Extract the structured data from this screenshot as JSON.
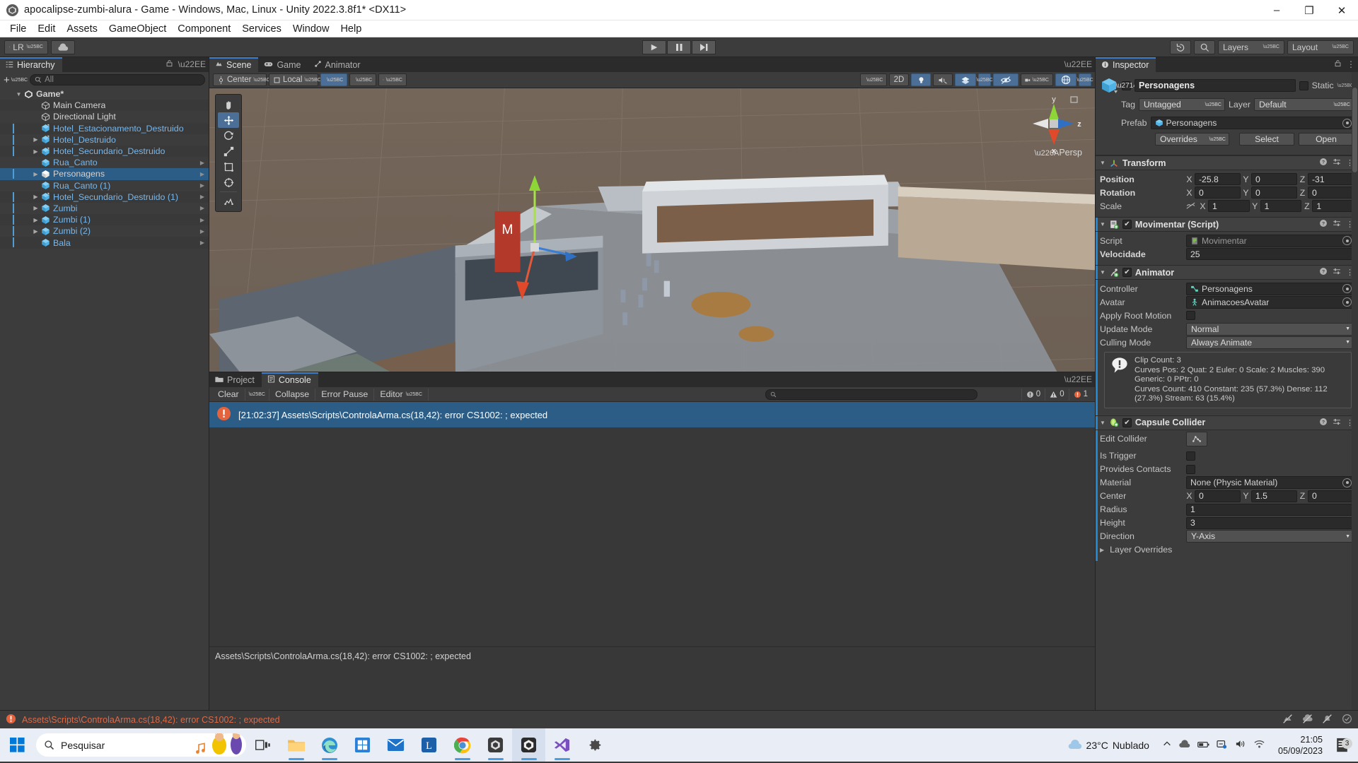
{
  "window": {
    "title": "apocalipse-zumbi-alura - Game - Windows, Mac, Linux - Unity 2022.3.8f1* <DX11>",
    "minimize": "–",
    "maximize": "❐",
    "close": "✕"
  },
  "menubar": {
    "items": [
      "File",
      "Edit",
      "Assets",
      "GameObject",
      "Component",
      "Services",
      "Window",
      "Help"
    ]
  },
  "toolbar": {
    "account_label": "LR",
    "cloud_label": "cloud-icon",
    "play": "▶",
    "pause": "❚❚",
    "step": "▶|",
    "history_icon": "undo-history-icon",
    "search_icon": "search-icon",
    "layers": "Layers",
    "layout": "Layout"
  },
  "hierarchy": {
    "tab": "Hierarchy",
    "search_placeholder": "All",
    "plus": "+",
    "items": [
      {
        "label": "Game*",
        "depth": 0,
        "arrow": "down",
        "icon": "unity-scene-icon",
        "color": "white",
        "prefab": false,
        "bold": true,
        "selected": false,
        "chevron": false
      },
      {
        "label": "Main Camera",
        "depth": 2,
        "arrow": "none",
        "icon": "gameobject-icon",
        "color": "white",
        "prefab": false,
        "bold": false,
        "selected": false,
        "chevron": false
      },
      {
        "label": "Directional Light",
        "depth": 2,
        "arrow": "none",
        "icon": "gameobject-icon",
        "color": "white",
        "prefab": false,
        "bold": false,
        "selected": false,
        "chevron": false
      },
      {
        "label": "Hotel_Estacionamento_Destruido",
        "depth": 2,
        "arrow": "none",
        "icon": "prefab-model-icon",
        "color": "blue",
        "prefab": true,
        "bold": false,
        "selected": false,
        "chevron": false
      },
      {
        "label": "Hotel_Destruido",
        "depth": 2,
        "arrow": "right",
        "icon": "prefab-model-icon",
        "color": "blue",
        "prefab": true,
        "bold": false,
        "selected": false,
        "chevron": false
      },
      {
        "label": "Hotel_Secundario_Destruido",
        "depth": 2,
        "arrow": "right",
        "icon": "prefab-model-icon",
        "color": "blue",
        "prefab": true,
        "bold": false,
        "selected": false,
        "chevron": false
      },
      {
        "label": "Rua_Canto",
        "depth": 2,
        "arrow": "none",
        "icon": "prefab-icon",
        "color": "blue",
        "prefab": false,
        "bold": false,
        "selected": false,
        "chevron": true
      },
      {
        "label": "Personagens",
        "depth": 2,
        "arrow": "right",
        "icon": "prefab-icon-white",
        "color": "white",
        "prefab": true,
        "bold": false,
        "selected": true,
        "chevron": true
      },
      {
        "label": "Rua_Canto (1)",
        "depth": 2,
        "arrow": "none",
        "icon": "prefab-icon",
        "color": "blue",
        "prefab": false,
        "bold": false,
        "selected": false,
        "chevron": true
      },
      {
        "label": "Hotel_Secundario_Destruido (1)",
        "depth": 2,
        "arrow": "right",
        "icon": "prefab-model-icon",
        "color": "blue",
        "prefab": true,
        "bold": false,
        "selected": false,
        "chevron": true
      },
      {
        "label": "Zumbi",
        "depth": 2,
        "arrow": "right",
        "icon": "prefab-icon",
        "color": "blue",
        "prefab": true,
        "bold": false,
        "selected": false,
        "chevron": true
      },
      {
        "label": "Zumbi (1)",
        "depth": 2,
        "arrow": "right",
        "icon": "prefab-icon",
        "color": "blue",
        "prefab": true,
        "bold": false,
        "selected": false,
        "chevron": true
      },
      {
        "label": "Zumbi (2)",
        "depth": 2,
        "arrow": "right",
        "icon": "prefab-icon",
        "color": "blue",
        "prefab": true,
        "bold": false,
        "selected": false,
        "chevron": true
      },
      {
        "label": "Bala",
        "depth": 2,
        "arrow": "none",
        "icon": "prefab-icon",
        "color": "blue",
        "prefab": true,
        "bold": false,
        "selected": false,
        "chevron": true
      }
    ]
  },
  "scene": {
    "tabs": [
      {
        "label": "Scene",
        "icon": "scene-icon",
        "active": true
      },
      {
        "label": "Game",
        "icon": "game-icon",
        "active": false
      },
      {
        "label": "Animator",
        "icon": "animator-icon",
        "active": false
      }
    ],
    "toolbar": {
      "pivot": "Center",
      "handle": "Local",
      "grid_icon": "grid-snap-icon",
      "snap_icon": "snap-increment-icon",
      "layout_icon": "align-icon",
      "shading_icon": "shading-mode-icon",
      "mode_2d": "2D",
      "lighting_icon": "lighting-icon",
      "audio_icon": "audio-mute-icon",
      "fx_icon": "effects-icon",
      "hidden_icon": "scene-visibility-icon",
      "camera_icon": "scene-camera-icon",
      "gizmos_icon": "gizmos-icon"
    },
    "tools": [
      "hand-tool",
      "move-tool",
      "rotate-tool",
      "scale-tool",
      "rect-tool",
      "transform-tool",
      "custom-editor-tool"
    ],
    "selected_tool_index": 1,
    "gizmo_axes": {
      "x": "x",
      "y": "y",
      "z": "z"
    },
    "persp_label": "Persp",
    "overflow_menu": "⋮"
  },
  "console": {
    "tabs": [
      {
        "label": "Project",
        "icon": "project-folder-icon",
        "active": false
      },
      {
        "label": "Console",
        "icon": "console-icon",
        "active": true
      }
    ],
    "clear": "Clear",
    "collapse": "Collapse",
    "error_pause": "Error Pause",
    "editor": "Editor",
    "search_placeholder": "",
    "counts": {
      "log": "0",
      "warning": "0",
      "error": "1"
    },
    "entries": [
      {
        "text": "[21:02:37] Assets\\Scripts\\ControlaArma.cs(18,42): error CS1002: ; expected",
        "type": "error",
        "selected": true
      }
    ],
    "detail": "Assets\\Scripts\\ControlaArma.cs(18,42): error CS1002: ; expected"
  },
  "inspector": {
    "tab": "Inspector",
    "lock_icon": "lock-icon",
    "menu_icon": "⋮",
    "object": {
      "name": "Personagens",
      "enabled": true,
      "static_label": "Static",
      "tag_label": "Tag",
      "tag_value": "Untagged",
      "layer_label": "Layer",
      "layer_value": "Default",
      "prefab_label": "Prefab",
      "prefab_value": "Personagens",
      "overrides": "Overrides",
      "select": "Select",
      "open": "Open"
    },
    "components": [
      {
        "title": "Transform",
        "icon": "transform-icon",
        "has_checkbox": false,
        "prefab_bar": false,
        "rows": [
          {
            "type": "vector3",
            "label": "Position",
            "bold": true,
            "x": "-25.8",
            "y": "0",
            "z": "-31"
          },
          {
            "type": "vector3",
            "label": "Rotation",
            "bold": true,
            "x": "0",
            "y": "0",
            "z": "0"
          },
          {
            "type": "vector3",
            "label": "Scale",
            "bold": false,
            "x": "1",
            "y": "1",
            "z": "1",
            "link_icon": "constrain-proportions-off-icon"
          }
        ]
      },
      {
        "title": "Movimentar (Script)",
        "icon": "script-icon",
        "has_checkbox": true,
        "checked": true,
        "prefab_bar": true,
        "rows": [
          {
            "type": "object",
            "label": "Script",
            "bold": false,
            "value": "Movimentar",
            "value_icon": "cs-script-icon",
            "dim": true
          },
          {
            "type": "text",
            "label": "Velocidade",
            "bold": true,
            "value": "25"
          }
        ]
      },
      {
        "title": "Animator",
        "icon": "animator-component-icon",
        "has_checkbox": true,
        "checked": true,
        "prefab_bar": true,
        "rows": [
          {
            "type": "object",
            "label": "Controller",
            "bold": false,
            "value": "Personagens",
            "value_icon": "animator-controller-icon"
          },
          {
            "type": "object",
            "label": "Avatar",
            "bold": false,
            "value": "AnimacoesAvatar",
            "value_icon": "avatar-icon"
          },
          {
            "type": "checkbox",
            "label": "Apply Root Motion",
            "bold": false,
            "checked": false
          },
          {
            "type": "dropdown",
            "label": "Update Mode",
            "bold": false,
            "value": "Normal"
          },
          {
            "type": "dropdown",
            "label": "Culling Mode",
            "bold": false,
            "value": "Always Animate"
          }
        ],
        "helpbox": {
          "icon": "info-icon",
          "lines": [
            "Clip Count: 3",
            "Curves Pos: 2 Quat: 2 Euler: 0 Scale: 2 Muscles: 390",
            "Generic: 0 PPtr: 0",
            "Curves Count: 410 Constant: 235 (57.3%) Dense: 112",
            "(27.3%) Stream: 63 (15.4%)"
          ]
        }
      },
      {
        "title": "Capsule Collider",
        "icon": "collider-icon",
        "has_checkbox": true,
        "checked": true,
        "prefab_bar": true,
        "rows": [
          {
            "type": "editcollider",
            "label": "Edit Collider",
            "bold": false,
            "button_icon": "edit-collider-icon"
          },
          {
            "type": "checkbox",
            "label": "Is Trigger",
            "bold": false,
            "checked": false
          },
          {
            "type": "checkbox",
            "label": "Provides Contacts",
            "bold": false,
            "checked": false
          },
          {
            "type": "object",
            "label": "Material",
            "bold": false,
            "value": "None (Physic Material)"
          },
          {
            "type": "vector3",
            "label": "Center",
            "bold": false,
            "x": "0",
            "y": "1.5",
            "z": "0"
          },
          {
            "type": "text",
            "label": "Radius",
            "bold": false,
            "value": "1"
          },
          {
            "type": "text",
            "label": "Height",
            "bold": false,
            "value": "3"
          },
          {
            "type": "dropdown",
            "label": "Direction",
            "bold": false,
            "value": "Y-Axis"
          },
          {
            "type": "foldout",
            "label": "Layer Overrides",
            "bold": false
          }
        ]
      }
    ]
  },
  "statusbar": {
    "message": "Assets\\Scripts\\ControlaArma.cs(18,42): error CS1002: ; expected",
    "icons": [
      "collab-off-icon",
      "cloud-off-icon",
      "notification-off-icon",
      "check-circle-icon"
    ]
  },
  "taskbar": {
    "start": "windows-start-icon",
    "search_placeholder": "Pesquisar",
    "items": [
      {
        "name": "task-view",
        "icon": "task-view-icon",
        "active": false,
        "underline": false
      },
      {
        "name": "file-explorer",
        "icon": "folder-icon",
        "active": false,
        "underline": true
      },
      {
        "name": "edge",
        "icon": "edge-icon",
        "active": false,
        "underline": true
      },
      {
        "name": "microsoft-store",
        "icon": "store-icon",
        "active": false,
        "underline": false
      },
      {
        "name": "mail",
        "icon": "mail-icon",
        "active": false,
        "underline": false
      },
      {
        "name": "alura",
        "icon": "alura-icon",
        "active": false,
        "underline": false
      },
      {
        "name": "chrome",
        "icon": "chrome-icon",
        "active": false,
        "underline": true
      },
      {
        "name": "unity-hub",
        "icon": "unity-hub-icon",
        "active": false,
        "underline": true
      },
      {
        "name": "unity-editor",
        "icon": "unity-icon",
        "active": true,
        "underline": true
      },
      {
        "name": "visual-studio",
        "icon": "vs-icon",
        "active": false,
        "underline": true
      },
      {
        "name": "settings",
        "icon": "gear-icon",
        "active": false,
        "underline": false
      }
    ],
    "weather": {
      "temp": "23°C",
      "condition": "Nublado"
    },
    "clock": {
      "time": "21:05",
      "date": "05/09/2023"
    },
    "notification_count": "3"
  },
  "colors": {
    "accent_blue": "#2c5d87",
    "prefab_blue": "#79b6e8",
    "error_red": "#e5633c",
    "panel_bg": "#3c3c3c"
  }
}
